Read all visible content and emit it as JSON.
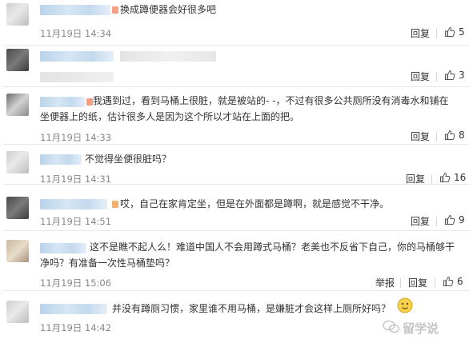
{
  "comments": [
    {
      "text": "换成蹲便器会好很多吧",
      "time": "11月19日 14:34",
      "reply": "回复",
      "likes": "5"
    },
    {
      "text": "",
      "time": "",
      "reply": "回复",
      "likes": "3"
    },
    {
      "line1": "我遇到过，看到马桶上很脏，就是被站的- -，不过有很多公共厕所没有消毒水和铺在",
      "line2": "坐便器上的纸，估计很多人是因为这个所以才站在上面的把。",
      "time": "11月19日 14:33",
      "reply": "回复",
      "likes": "8"
    },
    {
      "text": "不觉得坐便很脏吗？",
      "time": "11月19日 14:31",
      "reply": "回复",
      "likes": "16"
    },
    {
      "text": "哎，自己在家肯定坐，但是在外面都是蹲啊，就是感觉不干净。",
      "time": "11月19日 14:51",
      "reply": "回复",
      "likes": "9"
    },
    {
      "line1": "这不是瞧不起人么！难道中国人不会用蹲式马桶？老美也不反省下自己，你的马桶够干",
      "line2": "净吗？有准备一次性马桶垫吗？",
      "time": "11月19日 15:06",
      "report": "举报",
      "reply": "回复",
      "likes": "6"
    },
    {
      "text": "并没有蹲厕习惯，家里谁不用马桶，是嫌脏才会这样上厕所好吗？",
      "time": "11月19日 14:42"
    }
  ],
  "watermark": "留学说",
  "colors": {
    "accent_name": "#4a7fc0",
    "like_icon": "#555555",
    "divider": "#e8e8e8"
  }
}
